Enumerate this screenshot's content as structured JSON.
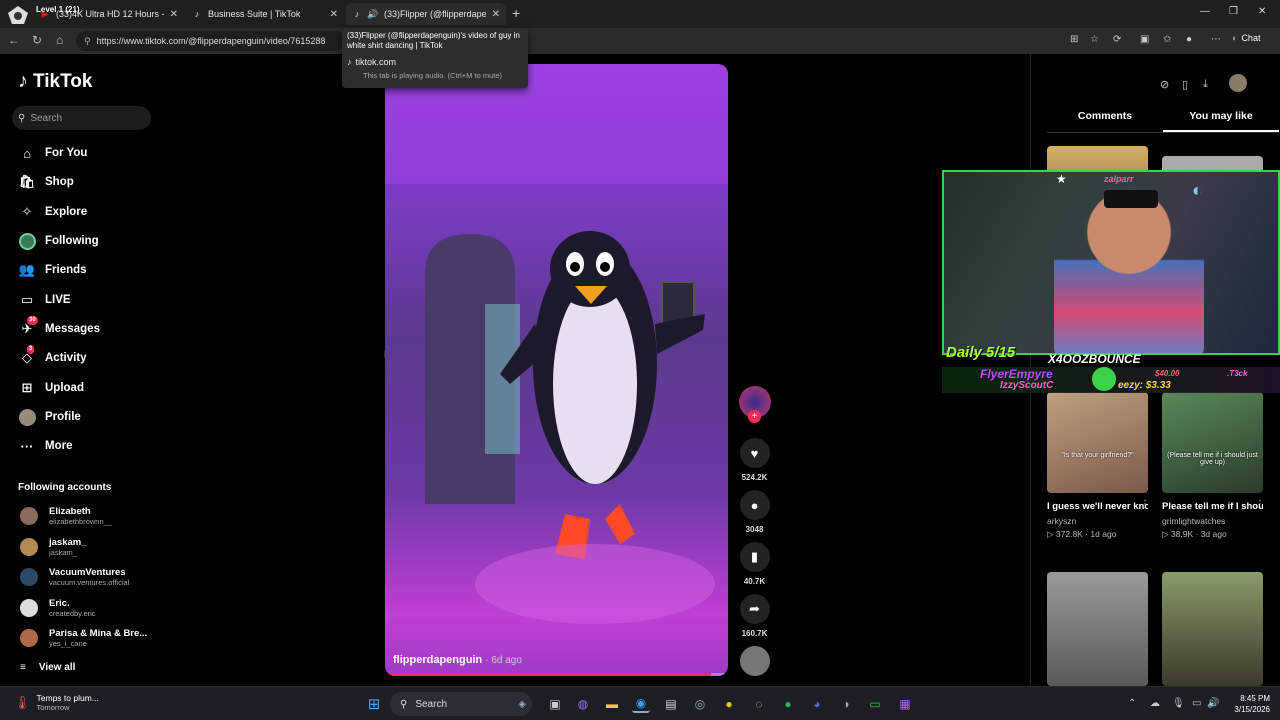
{
  "browser": {
    "overlay_text": [
      "Level 1  (21)"
    ],
    "tabs": [
      {
        "title": "(33)4K Ultra HD 12 Hours - Amb",
        "icon": "youtube-icon",
        "active": false
      },
      {
        "title": "Business Suite | TikTok",
        "icon": "tiktok-icon",
        "active": false
      },
      {
        "title": "(33)Flipper (@flipperdapengu",
        "icon": "tiktok-icon",
        "active": true
      }
    ],
    "url": "https://www.tiktok.com/@flipperdapenguin/video/7615288",
    "chat_label": "Chat",
    "tooltip": {
      "title": "(33)Flipper (@flipperdapenguin)'s video of guy in white shirt dancing | TikTok",
      "domain": "tiktok.com",
      "audio_note": "This tab is playing audio. (Ctrl+M to mute)"
    }
  },
  "sidebar": {
    "logo": "TikTok",
    "search_placeholder": "Search",
    "nav": [
      {
        "label": "For You",
        "icon": "home-icon"
      },
      {
        "label": "Shop",
        "icon": "shop-icon"
      },
      {
        "label": "Explore",
        "icon": "compass-icon"
      },
      {
        "label": "Following",
        "icon": "following-icon"
      },
      {
        "label": "Friends",
        "icon": "friends-icon"
      },
      {
        "label": "LIVE",
        "icon": "live-icon"
      },
      {
        "label": "Messages",
        "icon": "messages-icon",
        "badge": "30"
      },
      {
        "label": "Activity",
        "icon": "activity-icon",
        "badge": "3"
      },
      {
        "label": "Upload",
        "icon": "upload-icon"
      },
      {
        "label": "Profile",
        "icon": "profile-icon"
      },
      {
        "label": "More",
        "icon": "more-icon"
      }
    ],
    "following_title": "Following accounts",
    "accounts": [
      {
        "name": "Elizabeth",
        "handle": "elizabethbrownn__",
        "color": "#8a6a5a"
      },
      {
        "name": "jaskam_",
        "handle": "jaskam_",
        "color": "#b08a50"
      },
      {
        "name": "VacuumVentures",
        "handle": "vacuum.ventures.official",
        "color": "#2a4a6a"
      },
      {
        "name": "Eric.",
        "handle": "createdby.eric",
        "color": "#dddddd"
      },
      {
        "name": "Parisa & Mina & Bre...",
        "handle": "yes_i_cane",
        "color": "#b06a4a"
      }
    ],
    "view_all": "View all"
  },
  "video": {
    "author": "flipperdapenguin",
    "time": "· 6d ago",
    "progress": 0.95,
    "actions": [
      {
        "icon": "heart-icon",
        "count": "524.2K"
      },
      {
        "icon": "comment-icon",
        "count": "3048"
      },
      {
        "icon": "bookmark-icon",
        "count": "40.7K"
      },
      {
        "icon": "share-icon",
        "count": "160.7K"
      }
    ]
  },
  "right_panel": {
    "tabs": [
      "Comments",
      "You may like"
    ],
    "active_tab": "You may like",
    "cards": [
      {
        "caption": "\"Is that your girlfriend?\"",
        "desc": "I guess we'll never know... #arky...",
        "user": "arkyszn",
        "views": "372.8K",
        "age": "1d ago",
        "color": "#8a7060"
      },
      {
        "caption": "(Please tell me if i should just give up)",
        "desc": "Please tell me if I should just give ...",
        "user": "grimlightwatches",
        "views": "38.9K",
        "age": "3d ago",
        "color": "#4a6a4a"
      },
      {
        "caption": "",
        "desc": "",
        "user": "",
        "views": "",
        "age": "",
        "color": "#7a7a7a"
      },
      {
        "caption": "",
        "desc": "",
        "user": "",
        "views": "",
        "age": "",
        "color": "#6a7a5a"
      }
    ]
  },
  "stream_overlay": {
    "tag": "zalparr",
    "daily": "Daily 5/15",
    "name": "X4OOZBOUNCE",
    "alert_name": "FlyerEmpyre",
    "alert_amount": "$40.00",
    "alert_sub": "IzzyScoutC",
    "alert_sub2": "eezy: $3.33",
    "alert_tag": ".T3ck"
  },
  "taskbar": {
    "weather_title": "Temps to plum...",
    "weather_sub": "Tomorrow",
    "search_label": "Search",
    "time": "8:45 PM",
    "date": "3/15/2026"
  }
}
